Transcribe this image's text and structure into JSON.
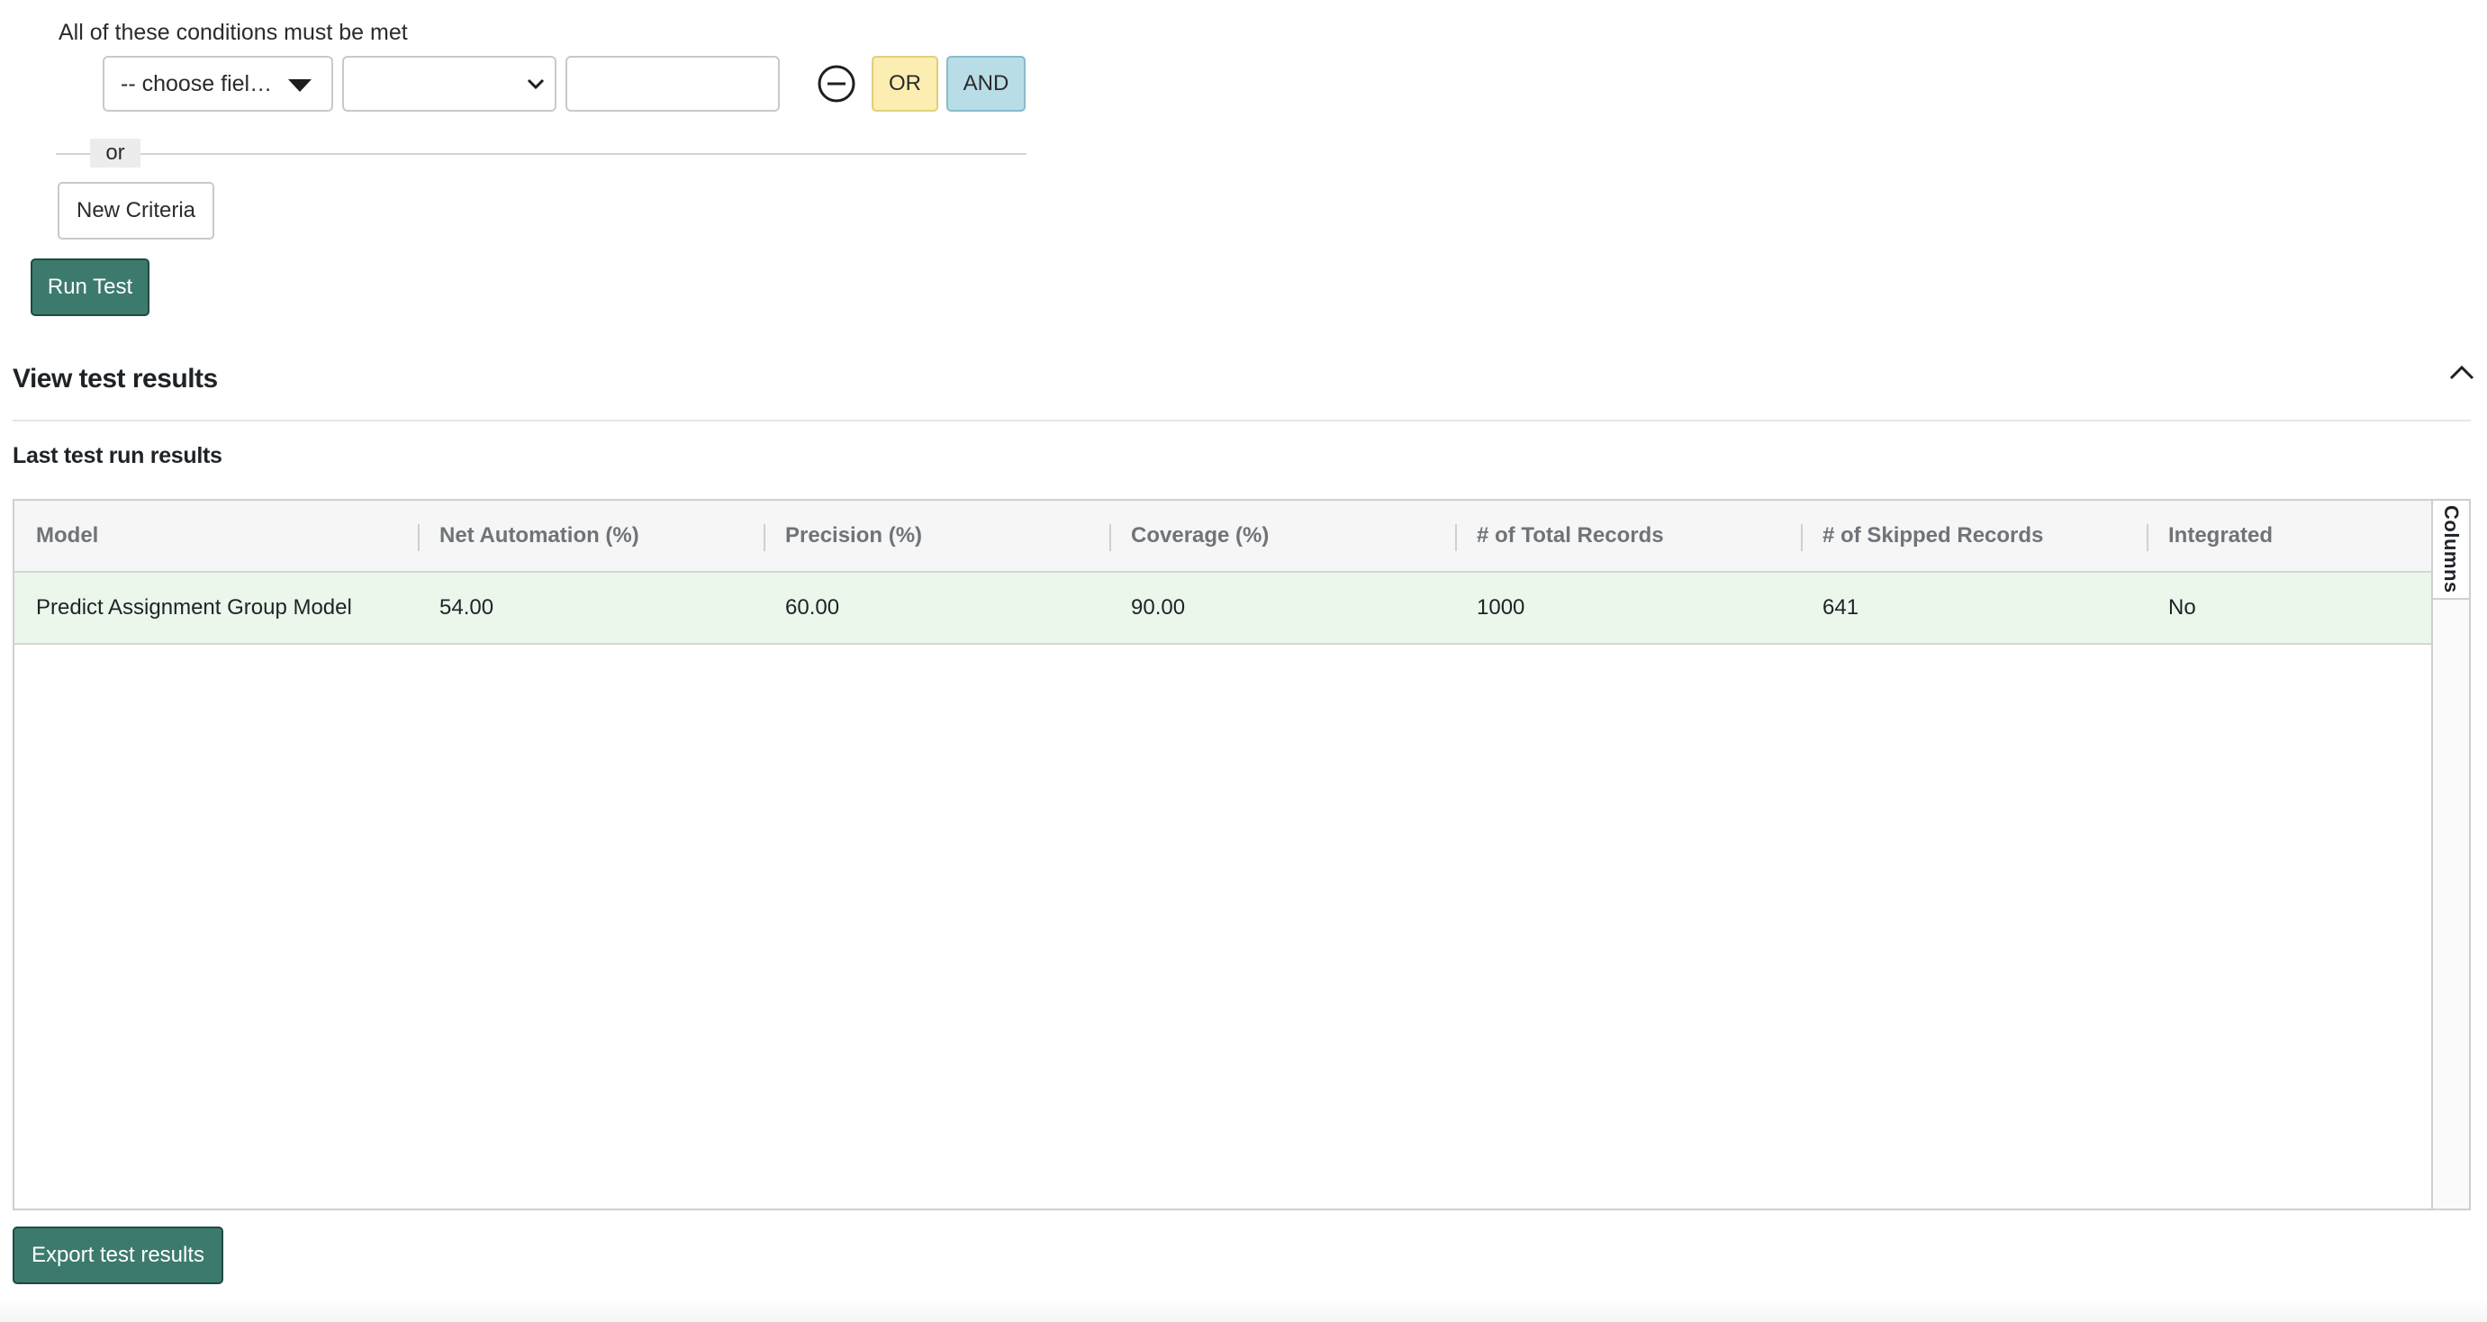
{
  "conditions": {
    "title": "All of these conditions must be met",
    "field_select": "-- choose fiel…",
    "operator_select": "",
    "value_input": "",
    "or_button": "OR",
    "and_button": "AND",
    "or_separator": "or",
    "new_criteria_button": "New Criteria"
  },
  "run_test_button": "Run Test",
  "results": {
    "section_title": "View test results",
    "subtitle": "Last test run results",
    "columns_tab": "Columns",
    "headers": [
      "Model",
      "Net Automation (%)",
      "Precision (%)",
      "Coverage (%)",
      "# of Total Records",
      "# of Skipped Records",
      "Integrated"
    ],
    "rows": [
      [
        "Predict Assignment Group Model",
        "54.00",
        "60.00",
        "90.00",
        "1000",
        "641",
        "No"
      ]
    ],
    "export_button": "Export test results"
  },
  "colors": {
    "primary_button": "#3d7a6e",
    "or_button": "#fbeeb0",
    "and_button": "#b9dde6",
    "row_highlight": "#eaf7ea"
  },
  "icons": {
    "field_caret": "caret-down-icon",
    "operator_chevron": "chevron-down-icon",
    "remove": "minus-circle-icon",
    "collapse": "chevron-up-icon"
  }
}
